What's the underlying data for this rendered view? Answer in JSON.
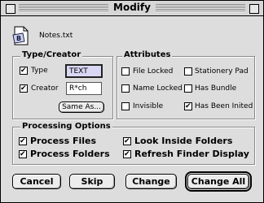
{
  "window": {
    "title": "Modify"
  },
  "file": {
    "name": "Notes.txt",
    "icon": "text-document-icon"
  },
  "type_creator": {
    "heading": "Type/Creator",
    "type_label": "Type",
    "type_value": "TEXT",
    "type_checked": true,
    "creator_label": "Creator",
    "creator_value": "R*ch",
    "creator_checked": true,
    "same_as_label": "Same As..."
  },
  "attributes": {
    "heading": "Attributes",
    "items": [
      {
        "label": "File Locked",
        "checked": false
      },
      {
        "label": "Stationery Pad",
        "checked": false
      },
      {
        "label": "Name Locked",
        "checked": false
      },
      {
        "label": "Has Bundle",
        "checked": false
      },
      {
        "label": "Invisible",
        "checked": false
      },
      {
        "label": "Has Been Inited",
        "checked": true
      }
    ]
  },
  "processing": {
    "heading": "Processing Options",
    "items": [
      {
        "label": "Process Files",
        "checked": true
      },
      {
        "label": "Look Inside Folders",
        "checked": true
      },
      {
        "label": "Process Folders",
        "checked": true
      },
      {
        "label": "Refresh Finder Display",
        "checked": true
      }
    ]
  },
  "buttons": {
    "cancel": "Cancel",
    "skip": "Skip",
    "change": "Change",
    "change_all": "Change All"
  }
}
